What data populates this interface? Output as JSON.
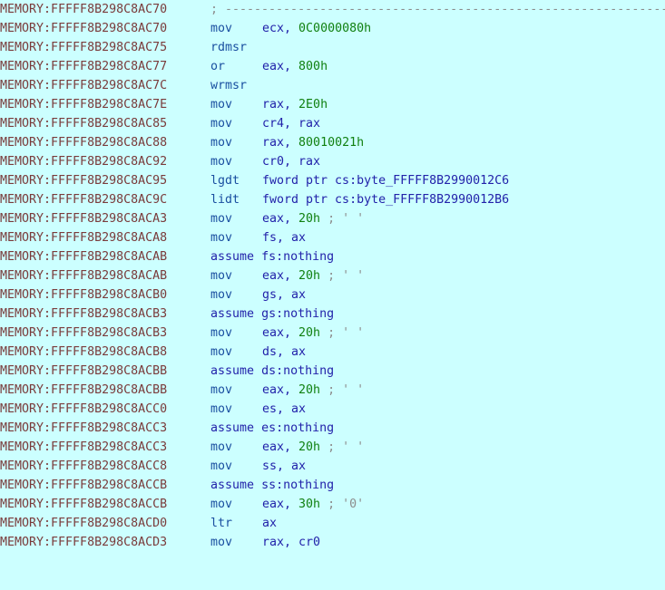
{
  "view": {
    "name": "IDA Pro disassembly listing",
    "segment": "MEMORY",
    "background_color": "#ccffff",
    "address_color": "#7a3b3b",
    "mnemonic_color": "#1a4fa0",
    "operand_color": "#2222aa",
    "number_color": "#108010",
    "comment_color": "#8c8c8c"
  },
  "lines": [
    {
      "addr": "MEMORY:FFFFF8B298C8AC70",
      "kind": "comment",
      "mnem": "",
      "comment": "; ------------------------------------------------------------------------"
    },
    {
      "addr": "MEMORY:FFFFF8B298C8AC70",
      "kind": "insn",
      "mnem": "mov",
      "op1": "ecx,",
      "op2": "0C0000080h",
      "op2class": "num",
      "comment": ""
    },
    {
      "addr": "MEMORY:FFFFF8B298C8AC75",
      "kind": "insn",
      "mnem": "rdmsr",
      "op1": "",
      "op2": "",
      "op2class": "reg",
      "comment": ""
    },
    {
      "addr": "MEMORY:FFFFF8B298C8AC77",
      "kind": "insn",
      "mnem": "or",
      "op1": "eax,",
      "op2": "800h",
      "op2class": "num",
      "comment": ""
    },
    {
      "addr": "MEMORY:FFFFF8B298C8AC7C",
      "kind": "insn",
      "mnem": "wrmsr",
      "op1": "",
      "op2": "",
      "op2class": "reg",
      "comment": ""
    },
    {
      "addr": "MEMORY:FFFFF8B298C8AC7E",
      "kind": "insn",
      "mnem": "mov",
      "op1": "rax,",
      "op2": "2E0h",
      "op2class": "num",
      "comment": ""
    },
    {
      "addr": "MEMORY:FFFFF8B298C8AC85",
      "kind": "insn",
      "mnem": "mov",
      "op1": "cr4,",
      "op2": "rax",
      "op2class": "reg",
      "comment": ""
    },
    {
      "addr": "MEMORY:FFFFF8B298C8AC88",
      "kind": "insn",
      "mnem": "mov",
      "op1": "rax,",
      "op2": "80010021h",
      "op2class": "num",
      "comment": ""
    },
    {
      "addr": "MEMORY:FFFFF8B298C8AC92",
      "kind": "insn",
      "mnem": "mov",
      "op1": "cr0,",
      "op2": "rax",
      "op2class": "reg",
      "comment": ""
    },
    {
      "addr": "MEMORY:FFFFF8B298C8AC95",
      "kind": "insn",
      "mnem": "lgdt",
      "op1": "fword ptr cs:byte_FFFFF8B2990012C6",
      "op2": "",
      "op2class": "name",
      "comment": ""
    },
    {
      "addr": "MEMORY:FFFFF8B298C8AC9C",
      "kind": "insn",
      "mnem": "lidt",
      "op1": "fword ptr cs:byte_FFFFF8B2990012B6",
      "op2": "",
      "op2class": "name",
      "comment": ""
    },
    {
      "addr": "MEMORY:FFFFF8B298C8ACA3",
      "kind": "insn",
      "mnem": "mov",
      "op1": "eax,",
      "op2": "20h",
      "op2class": "num",
      "comment": "; ' '"
    },
    {
      "addr": "MEMORY:FFFFF8B298C8ACA8",
      "kind": "insn",
      "mnem": "mov",
      "op1": "fs,",
      "op2": "ax",
      "op2class": "reg",
      "comment": ""
    },
    {
      "addr": "MEMORY:FFFFF8B298C8ACAB",
      "kind": "assume",
      "mnem": "assume",
      "op1": "fs:nothing",
      "op2": "",
      "op2class": "reg",
      "comment": ""
    },
    {
      "addr": "MEMORY:FFFFF8B298C8ACAB",
      "kind": "insn",
      "mnem": "mov",
      "op1": "eax,",
      "op2": "20h",
      "op2class": "num",
      "comment": "; ' '"
    },
    {
      "addr": "MEMORY:FFFFF8B298C8ACB0",
      "kind": "insn",
      "mnem": "mov",
      "op1": "gs,",
      "op2": "ax",
      "op2class": "reg",
      "comment": ""
    },
    {
      "addr": "MEMORY:FFFFF8B298C8ACB3",
      "kind": "assume",
      "mnem": "assume",
      "op1": "gs:nothing",
      "op2": "",
      "op2class": "reg",
      "comment": ""
    },
    {
      "addr": "MEMORY:FFFFF8B298C8ACB3",
      "kind": "insn",
      "mnem": "mov",
      "op1": "eax,",
      "op2": "20h",
      "op2class": "num",
      "comment": "; ' '"
    },
    {
      "addr": "MEMORY:FFFFF8B298C8ACB8",
      "kind": "insn",
      "mnem": "mov",
      "op1": "ds,",
      "op2": "ax",
      "op2class": "reg",
      "comment": ""
    },
    {
      "addr": "MEMORY:FFFFF8B298C8ACBB",
      "kind": "assume",
      "mnem": "assume",
      "op1": "ds:nothing",
      "op2": "",
      "op2class": "reg",
      "comment": ""
    },
    {
      "addr": "MEMORY:FFFFF8B298C8ACBB",
      "kind": "insn",
      "mnem": "mov",
      "op1": "eax,",
      "op2": "20h",
      "op2class": "num",
      "comment": "; ' '"
    },
    {
      "addr": "MEMORY:FFFFF8B298C8ACC0",
      "kind": "insn",
      "mnem": "mov",
      "op1": "es,",
      "op2": "ax",
      "op2class": "reg",
      "comment": ""
    },
    {
      "addr": "MEMORY:FFFFF8B298C8ACC3",
      "kind": "assume",
      "mnem": "assume",
      "op1": "es:nothing",
      "op2": "",
      "op2class": "reg",
      "comment": ""
    },
    {
      "addr": "MEMORY:FFFFF8B298C8ACC3",
      "kind": "insn",
      "mnem": "mov",
      "op1": "eax,",
      "op2": "20h",
      "op2class": "num",
      "comment": "; ' '"
    },
    {
      "addr": "MEMORY:FFFFF8B298C8ACC8",
      "kind": "insn",
      "mnem": "mov",
      "op1": "ss,",
      "op2": "ax",
      "op2class": "reg",
      "comment": ""
    },
    {
      "addr": "MEMORY:FFFFF8B298C8ACCB",
      "kind": "assume",
      "mnem": "assume",
      "op1": "ss:nothing",
      "op2": "",
      "op2class": "reg",
      "comment": ""
    },
    {
      "addr": "MEMORY:FFFFF8B298C8ACCB",
      "kind": "insn",
      "mnem": "mov",
      "op1": "eax,",
      "op2": "30h",
      "op2class": "num",
      "comment": "; '0'"
    },
    {
      "addr": "MEMORY:FFFFF8B298C8ACD0",
      "kind": "insn",
      "mnem": "ltr",
      "op1": "ax",
      "op2": "",
      "op2class": "reg",
      "comment": ""
    },
    {
      "addr": "MEMORY:FFFFF8B298C8ACD3",
      "kind": "insn",
      "mnem": "mov",
      "op1": "rax,",
      "op2": "cr0",
      "op2class": "reg",
      "comment": ""
    }
  ]
}
